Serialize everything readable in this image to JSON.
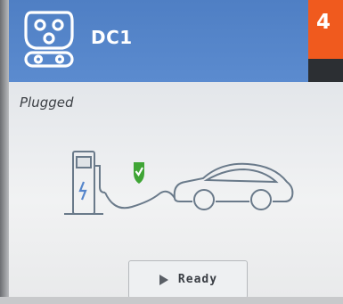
{
  "header": {
    "connector_icon": "ccs-connector-icon",
    "port_name": "DC1",
    "badge_text": "4"
  },
  "status": {
    "text": "Plugged"
  },
  "illustration": {
    "icons": [
      "charger-station-icon",
      "check-shield-icon",
      "charging-cable",
      "car-icon"
    ],
    "check_color": "#3fa535"
  },
  "actions": {
    "ready_label": "Ready",
    "ready_icon": "play-icon"
  },
  "colors": {
    "header": "#5585cb",
    "badge": "#f05a1e",
    "badge_bar": "#2c2f33"
  }
}
